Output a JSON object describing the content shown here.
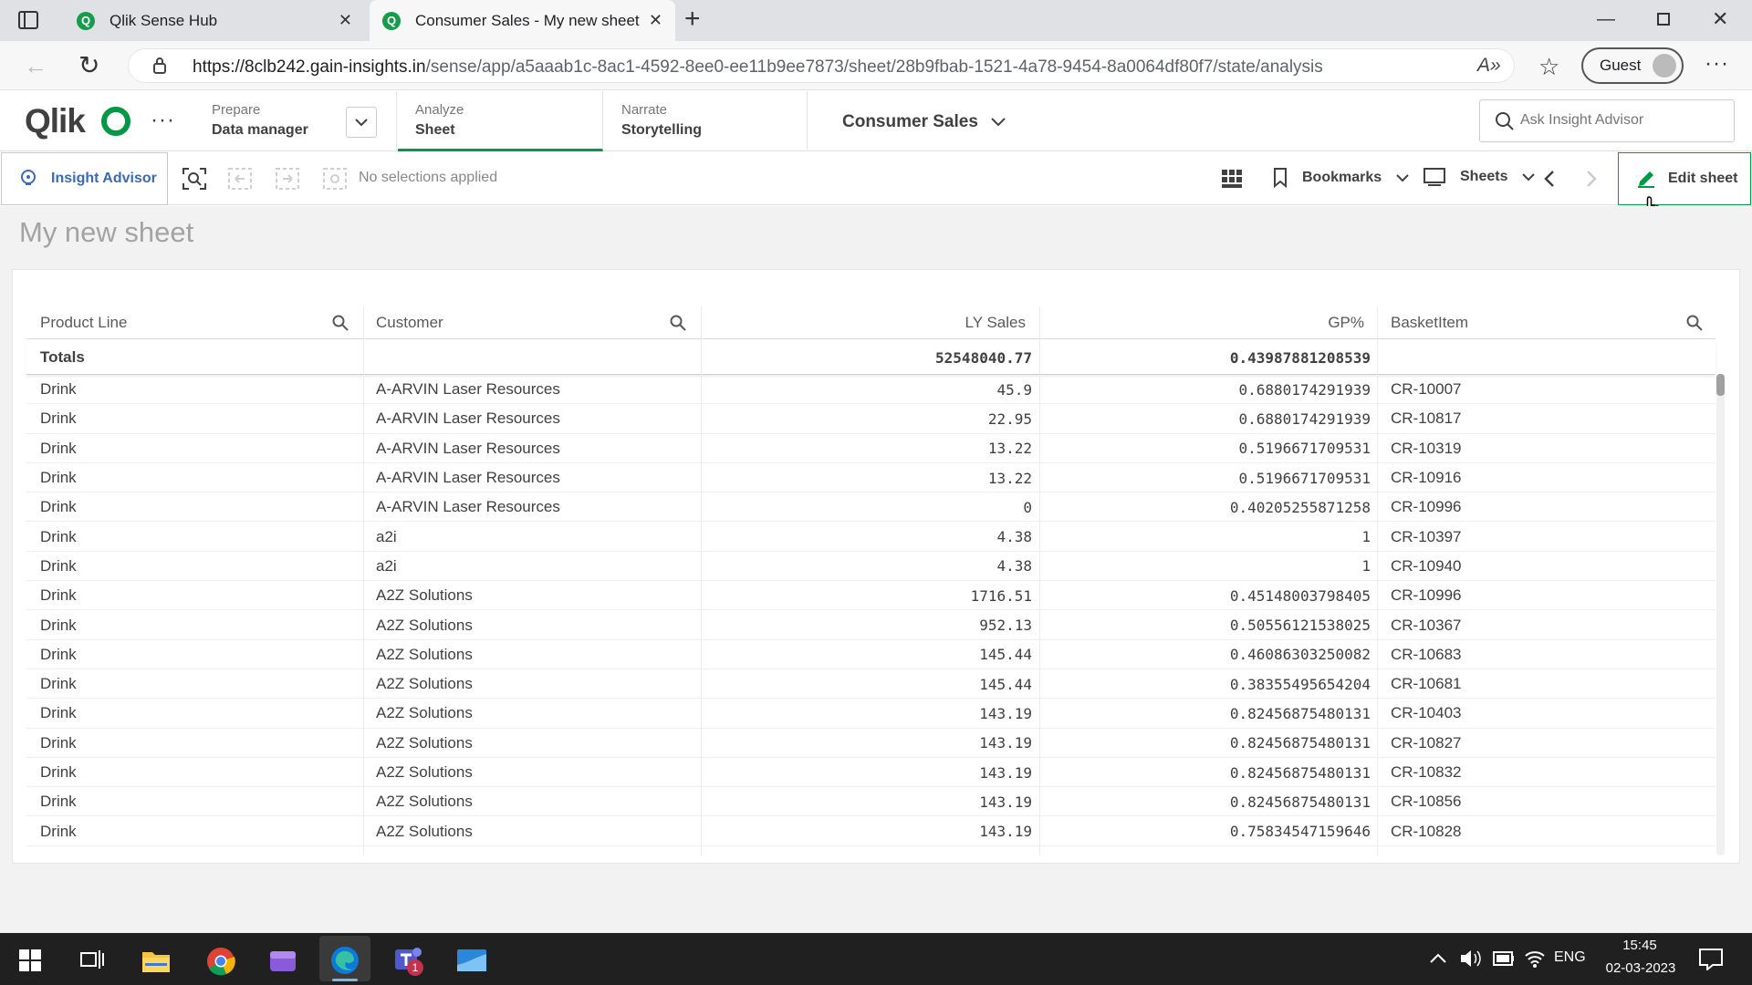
{
  "browser": {
    "tabs": [
      {
        "label": "Qlik Sense Hub",
        "active": false
      },
      {
        "label": "Consumer Sales - My new sheet",
        "active": true
      }
    ],
    "url_host": "https://8clb242.gain-insights.in",
    "url_path": "/sense/app/a5aaab1c-8ac1-4592-8ee0-ee11b9ee7873/sheet/28b9fbab-1521-4a78-9454-8a0064df80f7/state/analysis",
    "profile_label": "Guest"
  },
  "qlik": {
    "logo": "Qlik",
    "nav": [
      {
        "small": "Prepare",
        "big": "Data manager"
      },
      {
        "small": "Analyze",
        "big": "Sheet"
      },
      {
        "small": "Narrate",
        "big": "Storytelling"
      }
    ],
    "app_title": "Consumer Sales",
    "search_placeholder": "Ask Insight Advisor",
    "insight_advisor": "Insight Advisor",
    "selections": "No selections applied",
    "bookmarks": "Bookmarks",
    "sheets": "Sheets",
    "edit_sheet": "Edit sheet",
    "sheet_title": "My new sheet",
    "accent": "#009845"
  },
  "table": {
    "columns": [
      "Product Line",
      "Customer",
      "LY Sales",
      "GP%",
      "BasketItem"
    ],
    "totals": {
      "label": "Totals",
      "ly_sales": "52548040.77",
      "gp": "0.43987881208539"
    },
    "rows": [
      [
        "Drink",
        "A-ARVIN Laser Resources",
        "45.9",
        "0.6880174291939",
        "CR-10007"
      ],
      [
        "Drink",
        "A-ARVIN Laser Resources",
        "22.95",
        "0.6880174291939",
        "CR-10817"
      ],
      [
        "Drink",
        "A-ARVIN Laser Resources",
        "13.22",
        "0.5196671709531",
        "CR-10319"
      ],
      [
        "Drink",
        "A-ARVIN Laser Resources",
        "13.22",
        "0.5196671709531",
        "CR-10916"
      ],
      [
        "Drink",
        "A-ARVIN Laser Resources",
        "0",
        "0.40205255871258",
        "CR-10996"
      ],
      [
        "Drink",
        "a2i",
        "4.38",
        "1",
        "CR-10397"
      ],
      [
        "Drink",
        "a2i",
        "4.38",
        "1",
        "CR-10940"
      ],
      [
        "Drink",
        "A2Z Solutions",
        "1716.51",
        "0.45148003798405",
        "CR-10996"
      ],
      [
        "Drink",
        "A2Z Solutions",
        "952.13",
        "0.50556121538025",
        "CR-10367"
      ],
      [
        "Drink",
        "A2Z Solutions",
        "145.44",
        "0.46086303250082",
        "CR-10683"
      ],
      [
        "Drink",
        "A2Z Solutions",
        "145.44",
        "0.38355495654204",
        "CR-10681"
      ],
      [
        "Drink",
        "A2Z Solutions",
        "143.19",
        "0.82456875480131",
        "CR-10403"
      ],
      [
        "Drink",
        "A2Z Solutions",
        "143.19",
        "0.82456875480131",
        "CR-10827"
      ],
      [
        "Drink",
        "A2Z Solutions",
        "143.19",
        "0.82456875480131",
        "CR-10832"
      ],
      [
        "Drink",
        "A2Z Solutions",
        "143.19",
        "0.82456875480131",
        "CR-10856"
      ],
      [
        "Drink",
        "A2Z Solutions",
        "143.19",
        "0.75834547159646",
        "CR-10828"
      ]
    ]
  },
  "taskbar": {
    "lang": "ENG",
    "time": "15:45",
    "date": "02-03-2023",
    "teams_badge": "1"
  }
}
